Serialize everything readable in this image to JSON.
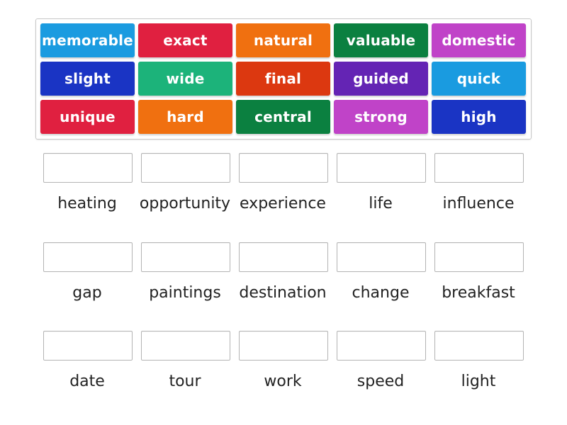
{
  "tiles": [
    {
      "label": "memorable",
      "color": "#1a9be0"
    },
    {
      "label": "exact",
      "color": "#e02040"
    },
    {
      "label": "natural",
      "color": "#f07010"
    },
    {
      "label": "valuable",
      "color": "#0b8040"
    },
    {
      "label": "domestic",
      "color": "#c043c8"
    },
    {
      "label": "slight",
      "color": "#1a34c4"
    },
    {
      "label": "wide",
      "color": "#1cb37a"
    },
    {
      "label": "final",
      "color": "#dc3810"
    },
    {
      "label": "guided",
      "color": "#6424b4"
    },
    {
      "label": "quick",
      "color": "#1a9be0"
    },
    {
      "label": "unique",
      "color": "#e02040"
    },
    {
      "label": "hard",
      "color": "#f07010"
    },
    {
      "label": "central",
      "color": "#0b8040"
    },
    {
      "label": "strong",
      "color": "#c043c8"
    },
    {
      "label": "high",
      "color": "#1a34c4"
    }
  ],
  "targets": [
    {
      "label": "heating"
    },
    {
      "label": "opportunity"
    },
    {
      "label": "experience"
    },
    {
      "label": "life"
    },
    {
      "label": "influence"
    },
    {
      "label": "gap"
    },
    {
      "label": "paintings"
    },
    {
      "label": "destination"
    },
    {
      "label": "change"
    },
    {
      "label": "breakfast"
    },
    {
      "label": "date"
    },
    {
      "label": "tour"
    },
    {
      "label": "work"
    },
    {
      "label": "speed"
    },
    {
      "label": "light"
    }
  ]
}
